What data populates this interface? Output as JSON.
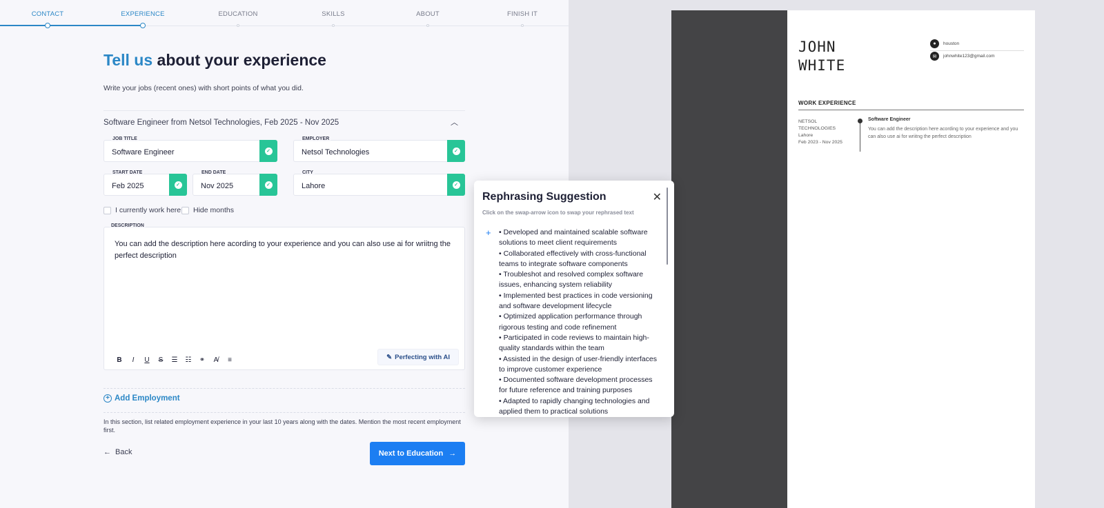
{
  "stepper": {
    "steps": [
      "CONTACT",
      "EXPERIENCE",
      "EDUCATION",
      "SKILLS",
      "ABOUT",
      "FINISH IT"
    ]
  },
  "page": {
    "title_highlight": "Tell us",
    "title_rest": " about your experience",
    "subtitle": "Write your jobs (recent ones) with short points of what you did."
  },
  "job": {
    "summary": "Software Engineer from Netsol Technologies, Feb 2025 - Nov 2025",
    "job_title_label": "JOB TITLE",
    "job_title": "Software Engineer",
    "employer_label": "EMPLOYER",
    "employer": "Netsol Technologies",
    "start_label": "START DATE",
    "start": "Feb 2025",
    "end_label": "END DATE",
    "end": "Nov 2025",
    "city_label": "CITY",
    "city": "Lahore",
    "current_label": "I currently work here",
    "hide_months_label": "Hide months",
    "description_label": "DESCRIPTION",
    "description": "You can add the description here acording to your experience and you can also use ai for wriitng the perfect description",
    "ai_button": "Perfecting with AI"
  },
  "actions": {
    "add_employment": "Add Employment",
    "hint": "In this section, list related employment experience in your last 10 years along with the dates. Mention the most recent employment first.",
    "back": "Back",
    "next": "Next to Education"
  },
  "popup": {
    "title": "Rephrasing Suggestion",
    "subtitle": "Click on the swap-arrow icon to swap your rephrased text",
    "items": [
      "• Developed and maintained scalable software solutions to meet client requirements",
      "• Collaborated effectively with cross-functional teams to integrate software components",
      "• Troubleshot and resolved complex software issues, enhancing system reliability",
      "• Implemented best practices in code versioning and software development lifecycle",
      "• Optimized application performance through rigorous testing and code refinement",
      "• Participated in code reviews to maintain high-quality standards within the team",
      "• Assisted in the design of user-friendly interfaces to improve customer experience",
      "• Documented software development processes for future reference and training purposes",
      "• Adapted to rapidly changing technologies and applied them to practical solutions"
    ]
  },
  "resume": {
    "first_name": "JOHN",
    "last_name": "WHITE",
    "location": "houston",
    "email": "johnwhite123@gmail.com",
    "section_title": "WORK EXPERIENCE",
    "company_line1": "NETSOL",
    "company_line2": "TECHNOLOGIES",
    "city": "Lahore",
    "dates": "Feb 2023 - Nov 2025",
    "role": "Software Engineer",
    "description": "You can add the description here acording to your experience and you can also use ai for wriitng the perfect description"
  },
  "colors": {
    "accent": "#2b87c6",
    "primary_button": "#1c7ef2",
    "success": "#28c597",
    "resume_sidebar": "#444446"
  }
}
